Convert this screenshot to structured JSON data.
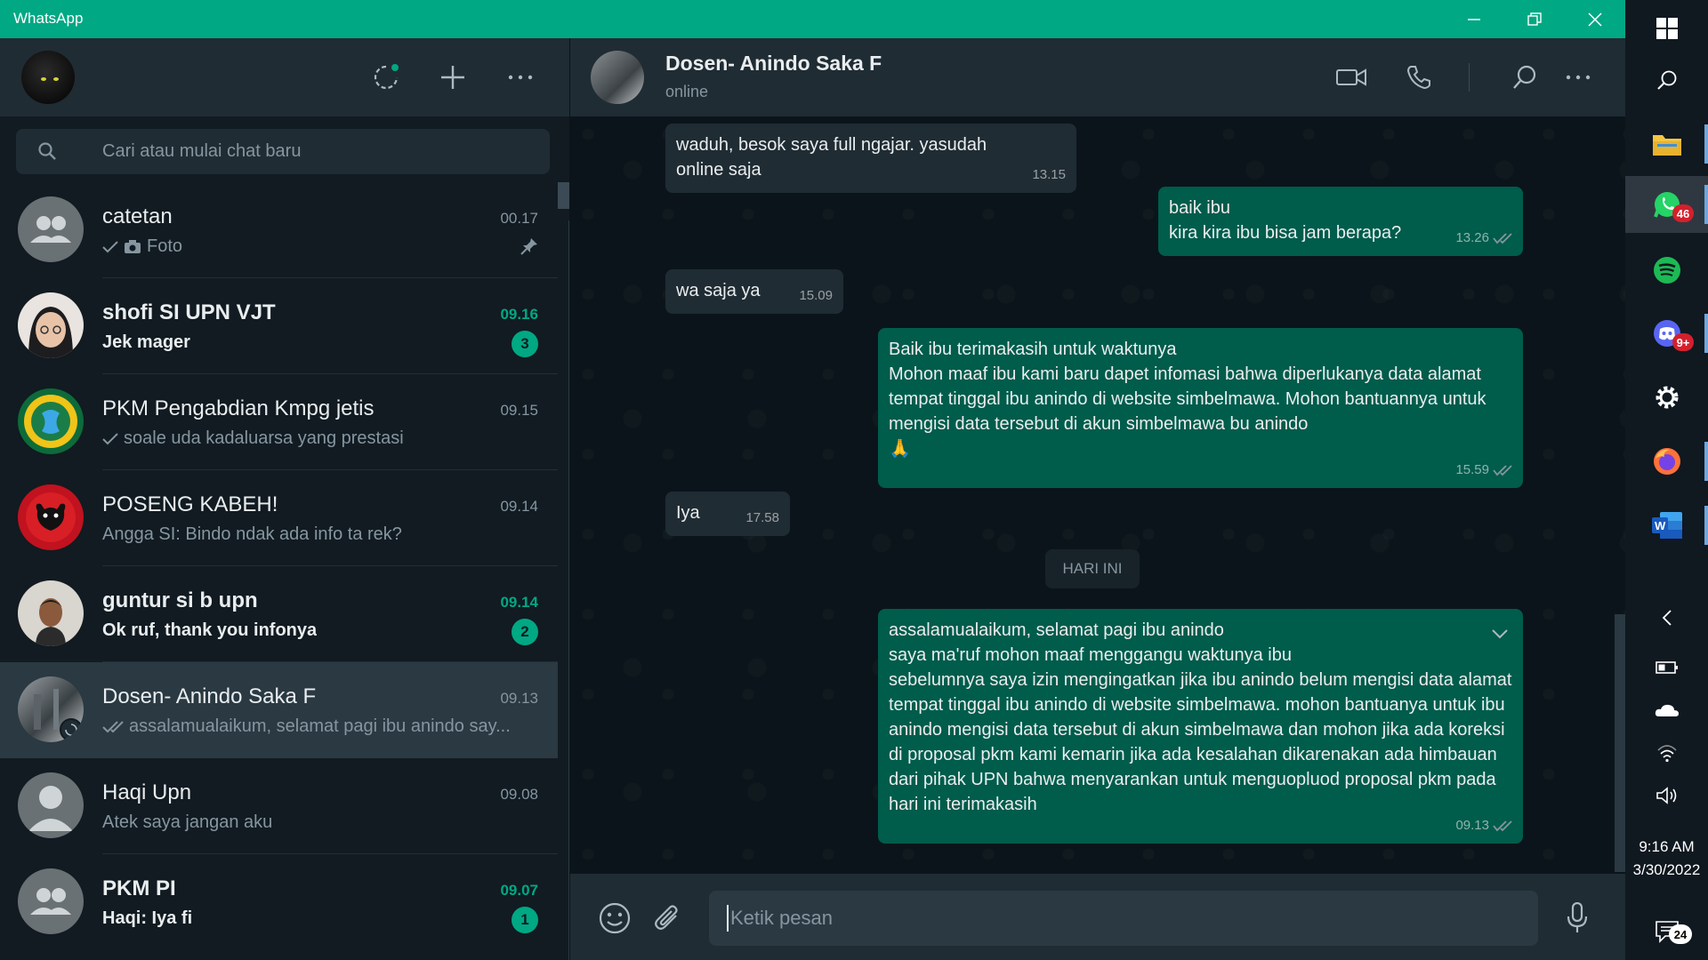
{
  "window": {
    "title": "WhatsApp"
  },
  "search": {
    "placeholder": "Cari atau mulai chat baru"
  },
  "chats": [
    {
      "name": "catetan",
      "time": "00.17",
      "preview": "Foto",
      "pinned": true
    },
    {
      "name": "shofi SI UPN VJT",
      "time": "09.16",
      "preview": "Jek mager",
      "unread": "3"
    },
    {
      "name": "PKM Pengabdian Kmpg jetis",
      "time": "09.15",
      "preview": "soale uda kadaluarsa yang prestasi"
    },
    {
      "name": "POSENG KABEH!",
      "time": "09.14",
      "preview": "Angga SI: Bindo ndak ada info ta rek?"
    },
    {
      "name": "guntur si b upn",
      "time": "09.14",
      "preview": "Ok ruf, thank you infonya",
      "unread": "2"
    },
    {
      "name": "Dosen- Anindo Saka F",
      "time": "09.13",
      "preview": "assalamualaikum, selamat pagi ibu anindo say..."
    },
    {
      "name": "Haqi Upn",
      "time": "09.08",
      "preview": "Atek saya jangan aku"
    },
    {
      "name": "PKM PI",
      "time": "09.07",
      "preview": "Haqi: Iya fi",
      "unread": "1"
    }
  ],
  "conversation": {
    "name": "Dosen- Anindo Saka F",
    "status": "online",
    "date_chip": "HARI INI",
    "messages": [
      {
        "dir": "in",
        "text": "waduh, besok saya full ngajar. yasudah online saja",
        "time": "13.15"
      },
      {
        "dir": "out",
        "text": "baik ibu\nkira kira ibu bisa jam berapa?",
        "time": "13.26"
      },
      {
        "dir": "in",
        "text": "wa saja ya",
        "time": "15.09"
      },
      {
        "dir": "out",
        "text": "Baik ibu terimakasih untuk waktunya\nMohon maaf ibu kami baru dapet infomasi bahwa diperlukanya data alamat tempat tinggal ibu anindo di website simbelmawa. Mohon bantuannya untuk mengisi data tersebut di akun simbelmawa bu anindo\n🙏",
        "time": "15.59"
      },
      {
        "dir": "in",
        "text": "Iya",
        "time": "17.58"
      },
      {
        "dir": "out",
        "text": "assalamualaikum, selamat pagi ibu anindo\nsaya ma'ruf mohon maaf menggangu waktunya ibu\nsebelumnya saya izin mengingatkan jika ibu anindo belum mengisi data alamat tempat tinggal ibu anindo di website simbelmawa. mohon bantuanya untuk ibu anindo mengisi data tersebut di akun simbelmawa dan mohon jika ada koreksi di proposal pkm kami kemarin jika ada kesalahan dikarenakan ada himbauan dari pihak UPN bahwa menyarankan untuk menguopluod proposal pkm pada hari ini terimakasih",
        "time": "09.13"
      }
    ],
    "input_placeholder": "Ketik pesan"
  },
  "taskbar": {
    "whatsapp_badge": "46",
    "discord_badge": "9+",
    "time": "9:16 AM",
    "date": "3/30/2022",
    "notifications": "24"
  },
  "colors": {
    "accent": "#00a884",
    "outgoing": "#005c4b",
    "incoming": "#202c33",
    "panel": "#111b21"
  }
}
